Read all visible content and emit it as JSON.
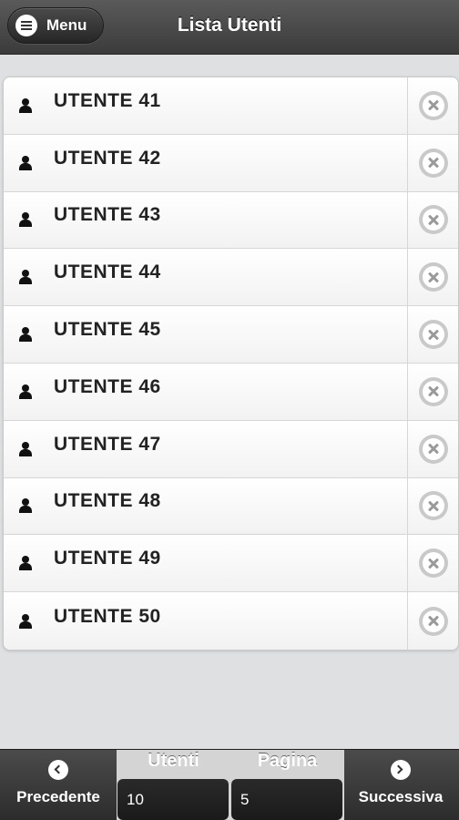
{
  "header": {
    "menu_label": "Menu",
    "title": "Lista Utenti"
  },
  "users": [
    {
      "label": "UTENTE 41"
    },
    {
      "label": "UTENTE 42"
    },
    {
      "label": "UTENTE 43"
    },
    {
      "label": "UTENTE 44"
    },
    {
      "label": "UTENTE 45"
    },
    {
      "label": "UTENTE 46"
    },
    {
      "label": "UTENTE 47"
    },
    {
      "label": "UTENTE 48"
    },
    {
      "label": "UTENTE 49"
    },
    {
      "label": "UTENTE 50"
    }
  ],
  "icons": {
    "menu": "hamburger-icon",
    "user": "user-icon",
    "delete": "close-circle-icon",
    "prev": "chevron-left-icon",
    "next": "chevron-right-icon"
  },
  "footer": {
    "prev_label": "Precedente",
    "next_label": "Successiva",
    "users_header": "Utenti",
    "users_value": "10",
    "page_header": "Pagina",
    "page_value": "5"
  }
}
